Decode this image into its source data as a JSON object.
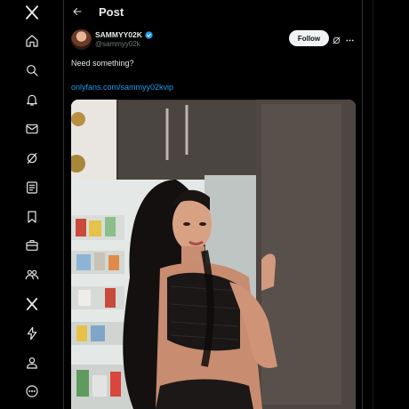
{
  "header": {
    "title": "Post"
  },
  "post": {
    "author_name": "SAMMYY02K",
    "author_handle": "@sammyy02k",
    "follow_label": "Follow",
    "text": "Need something?",
    "link_text": "onlyfans.com/sammyy02kvip"
  },
  "nav": [
    {
      "icon": "x-logo-icon"
    },
    {
      "icon": "home-icon"
    },
    {
      "icon": "search-icon"
    },
    {
      "icon": "bell-icon"
    },
    {
      "icon": "mail-icon"
    },
    {
      "icon": "grok-icon"
    },
    {
      "icon": "lists-icon"
    },
    {
      "icon": "bookmark-icon"
    },
    {
      "icon": "briefcase-icon"
    },
    {
      "icon": "communities-icon"
    },
    {
      "icon": "premium-icon"
    },
    {
      "icon": "lightning-icon"
    },
    {
      "icon": "profile-icon"
    },
    {
      "icon": "more-circle-icon"
    }
  ],
  "colors": {
    "background": "#000000",
    "accent": "#1d9bf0",
    "text": "#e7e9ea",
    "muted": "#71767b",
    "border": "#2f3336"
  }
}
